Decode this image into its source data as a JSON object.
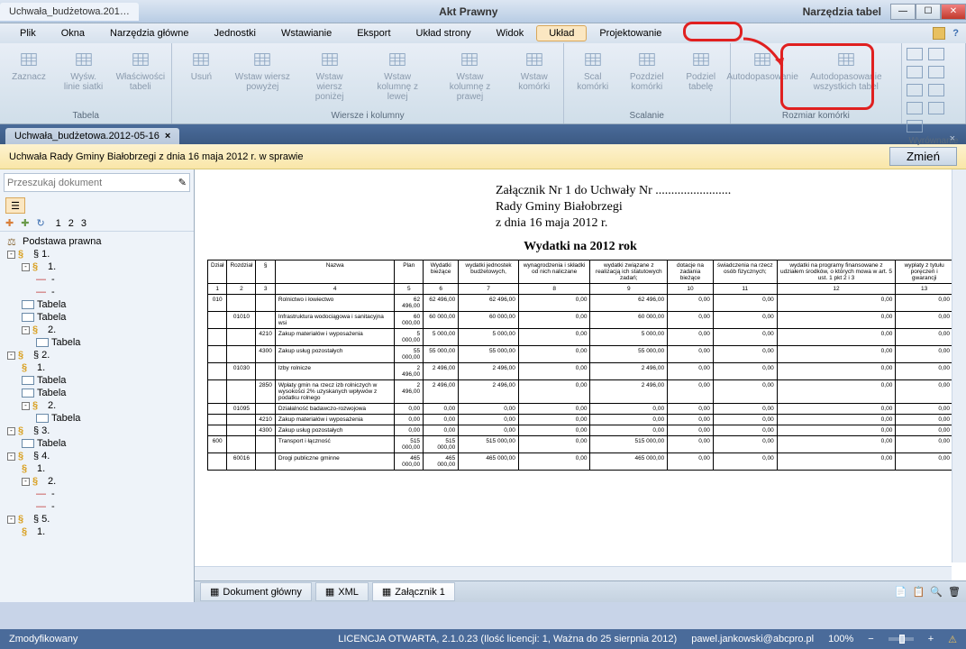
{
  "window": {
    "title_tab": "Uchwała_budżetowa.201…",
    "title_center": "Akt Prawny",
    "title_right": "Narzędzia tabel"
  },
  "menu": {
    "items": [
      "Plik",
      "Okna",
      "Narzędzia główne",
      "Jednostki",
      "Wstawianie",
      "Eksport",
      "Układ strony",
      "Widok",
      "Układ",
      "Projektowanie"
    ],
    "active": "Układ"
  },
  "ribbon": {
    "groups": [
      {
        "label": "Tabela",
        "buttons": [
          {
            "n": "Zaznacz"
          },
          {
            "n": "Wyśw. linie siatki"
          },
          {
            "n": "Właściwości tabeli"
          }
        ]
      },
      {
        "label": "Wiersze i kolumny",
        "buttons": [
          {
            "n": "Usuń"
          },
          {
            "n": "Wstaw wiersz powyżej"
          },
          {
            "n": "Wstaw wiersz poniżej"
          },
          {
            "n": "Wstaw kolumnę z lewej"
          },
          {
            "n": "Wstaw kolumnę z prawej"
          },
          {
            "n": "Wstaw komórki"
          }
        ]
      },
      {
        "label": "Scalanie",
        "buttons": [
          {
            "n": "Scal komórki"
          },
          {
            "n": "Pozdziel komórki"
          },
          {
            "n": "Podziel tabelę"
          }
        ]
      },
      {
        "label": "Rozmiar komórki",
        "buttons": [
          {
            "n": "Autodopasowanie"
          },
          {
            "n": "Autodopasowanie wszystkich tabel"
          }
        ]
      },
      {
        "label": "Wyrównanie",
        "buttons": []
      }
    ]
  },
  "doctab": "Uchwała_budżetowa.2012-05-16",
  "yellowbar": {
    "text": "Uchwała Rady Gminy Białobrzegi z dnia 16 maja 2012 r. w sprawie",
    "button": "Zmień"
  },
  "search_placeholder": "Przeszukaj dokument",
  "side_nums": [
    "1",
    "2",
    "3"
  ],
  "tree": [
    {
      "l": 0,
      "t": "Podstawa prawna",
      "ic": "law"
    },
    {
      "l": 0,
      "t": "§ 1.",
      "pm": "-",
      "ic": "sec"
    },
    {
      "l": 1,
      "t": "1.",
      "pm": "-",
      "ic": "sec"
    },
    {
      "l": 2,
      "t": "-",
      "ic": "dash"
    },
    {
      "l": 2,
      "t": "-",
      "ic": "dash"
    },
    {
      "l": 1,
      "t": "Tabela",
      "ic": "tbl"
    },
    {
      "l": 1,
      "t": "Tabela",
      "ic": "tbl"
    },
    {
      "l": 1,
      "t": "2.",
      "pm": "-",
      "ic": "sec"
    },
    {
      "l": 2,
      "t": "Tabela",
      "ic": "tbl"
    },
    {
      "l": 0,
      "t": "§ 2.",
      "pm": "-",
      "ic": "sec"
    },
    {
      "l": 1,
      "t": "1.",
      "ic": "sec"
    },
    {
      "l": 1,
      "t": "Tabela",
      "ic": "tbl"
    },
    {
      "l": 1,
      "t": "Tabela",
      "ic": "tbl"
    },
    {
      "l": 1,
      "t": "2.",
      "pm": "-",
      "ic": "sec"
    },
    {
      "l": 2,
      "t": "Tabela",
      "ic": "tbl"
    },
    {
      "l": 0,
      "t": "§ 3.",
      "pm": "-",
      "ic": "sec"
    },
    {
      "l": 1,
      "t": "Tabela",
      "ic": "tbl"
    },
    {
      "l": 0,
      "t": "§ 4.",
      "pm": "-",
      "ic": "sec"
    },
    {
      "l": 1,
      "t": "1.",
      "ic": "sec"
    },
    {
      "l": 1,
      "t": "2.",
      "pm": "-",
      "ic": "sec"
    },
    {
      "l": 2,
      "t": "-",
      "ic": "dash"
    },
    {
      "l": 2,
      "t": "-",
      "ic": "dash"
    },
    {
      "l": 0,
      "t": "§ 5.",
      "pm": "-",
      "ic": "sec"
    },
    {
      "l": 1,
      "t": "1.",
      "ic": "sec"
    }
  ],
  "page": {
    "h1": "Załącznik Nr 1 do Uchwały Nr ........................",
    "h2": "Rady Gminy Białobrzegi",
    "h3": "z dnia 16 maja 2012 r.",
    "title": "Wydatki na 2012 rok",
    "headers": [
      "Dział",
      "Rozdział",
      "§",
      "Nazwa",
      "Plan",
      "Wydatki bieżące",
      "wydatki jednostek budżetowych,",
      "wynagrodzenia i składki od nich naliczane",
      "wydatki związane z realizacją ich statutowych zadań;",
      "dotacje na zadania bieżące",
      "świadczenia na rzecz osób fizycznych;",
      "wydatki na programy finansowane z udziałem środków, o których mowa w art. 5 ust. 1 pkt 2 i 3",
      "wypłaty z tytułu poręczeń i gwarancji"
    ],
    "numrow": [
      "1",
      "2",
      "3",
      "4",
      "5",
      "6",
      "7",
      "8",
      "9",
      "10",
      "11",
      "12",
      "13"
    ],
    "rows": [
      [
        "010",
        "",
        "",
        "Rolnictwo i łowiectwo",
        "62 496,00",
        "62 496,00",
        "62 496,00",
        "0,00",
        "62 496,00",
        "0,00",
        "0,00",
        "0,00",
        "0,00"
      ],
      [
        "",
        "01010",
        "",
        "Infrastruktura wodociągowa i sanitacyjna wsi",
        "60 000,00",
        "60 000,00",
        "60 000,00",
        "0,00",
        "60 000,00",
        "0,00",
        "0,00",
        "0,00",
        "0,00"
      ],
      [
        "",
        "",
        "4210",
        "Zakup materiałów i wyposażenia",
        "5 000,00",
        "5 000,00",
        "5 000,00",
        "0,00",
        "5 000,00",
        "0,00",
        "0,00",
        "0,00",
        "0,00"
      ],
      [
        "",
        "",
        "4300",
        "Zakup usług pozostałych",
        "55 000,00",
        "55 000,00",
        "55 000,00",
        "0,00",
        "55 000,00",
        "0,00",
        "0,00",
        "0,00",
        "0,00"
      ],
      [
        "",
        "01030",
        "",
        "Izby rolnicze",
        "2 496,00",
        "2 496,00",
        "2 496,00",
        "0,00",
        "2 496,00",
        "0,00",
        "0,00",
        "0,00",
        "0,00"
      ],
      [
        "",
        "",
        "2850",
        "Wpłaty gmin na rzecz izb rolniczych w wysokości 2% uzyskanych wpływów z podatku rolnego",
        "2 496,00",
        "2 496,00",
        "2 496,00",
        "0,00",
        "2 496,00",
        "0,00",
        "0,00",
        "0,00",
        "0,00"
      ],
      [
        "",
        "01095",
        "",
        "Działalność badawczo-rozwojowa",
        "0,00",
        "0,00",
        "0,00",
        "0,00",
        "0,00",
        "0,00",
        "0,00",
        "0,00",
        "0,00"
      ],
      [
        "",
        "",
        "4210",
        "Zakup materiałów i wyposażenia",
        "0,00",
        "0,00",
        "0,00",
        "0,00",
        "0,00",
        "0,00",
        "0,00",
        "0,00",
        "0,00"
      ],
      [
        "",
        "",
        "4300",
        "Zakup usług pozostałych",
        "0,00",
        "0,00",
        "0,00",
        "0,00",
        "0,00",
        "0,00",
        "0,00",
        "0,00",
        "0,00"
      ],
      [
        "600",
        "",
        "",
        "Transport i łączność",
        "515 000,00",
        "515 000,00",
        "515 000,00",
        "0,00",
        "515 000,00",
        "0,00",
        "0,00",
        "0,00",
        "0,00"
      ],
      [
        "",
        "60016",
        "",
        "Drogi publiczne gminne",
        "465 000,00",
        "465 000,00",
        "465 000,00",
        "0,00",
        "465 000,00",
        "0,00",
        "0,00",
        "0,00",
        "0,00"
      ]
    ]
  },
  "bottom_tabs": [
    {
      "l": "Dokument główny",
      "ic": "doc"
    },
    {
      "l": "XML",
      "ic": "xml"
    },
    {
      "l": "Załącznik 1",
      "ic": "att",
      "active": true
    }
  ],
  "status": {
    "left": "Zmodyfikowany",
    "lic": "LICENCJA OTWARTA, 2.1.0.23 (Ilość licencji: 1, Ważna do 25 sierpnia 2012)",
    "user": "pawel.jankowski@abcpro.pl",
    "zoom": "100%"
  }
}
